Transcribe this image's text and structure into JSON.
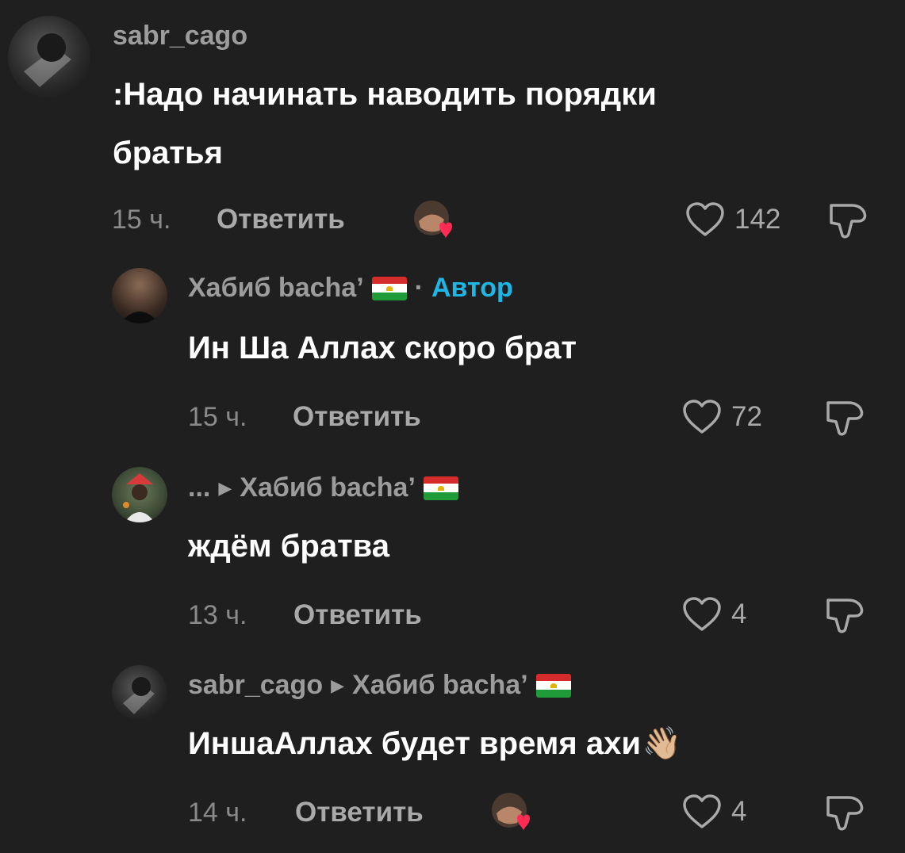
{
  "comments": [
    {
      "username": "sabr_cago",
      "text_line1": ":Надо начинать наводить порядки",
      "text_line2": "братья",
      "time": "15 ч.",
      "reply_label": "Ответить",
      "likes": "142",
      "creator_liked": true
    },
    {
      "username": "Хабиб bacha’",
      "separator": "·",
      "author_badge": "Автор",
      "text": "Ин Ша Аллах скоро брат",
      "time": "15 ч.",
      "reply_label": "Ответить",
      "likes": "72",
      "creator_liked": false
    },
    {
      "username": "...",
      "reply_to": "Хабиб bacha’",
      "text": "ждём братва",
      "time": "13 ч.",
      "reply_label": "Ответить",
      "likes": "4",
      "creator_liked": false
    },
    {
      "username": "sabr_cago",
      "reply_to": "Хабиб bacha’",
      "text": "ИншаАллах будет время ахи",
      "emoji": "👋🏼",
      "time": "14 ч.",
      "reply_label": "Ответить",
      "likes": "4",
      "creator_liked": true
    }
  ],
  "icons": {
    "like": "heart-outline-icon",
    "dislike": "thumbs-down-icon",
    "flag": "tajikistan-flag-icon",
    "reply_arrow": "triangle-right-icon"
  },
  "colors": {
    "background": "#1f1f1f",
    "author_badge": "#1fb6e6",
    "heart_badge": "#fe2c55"
  }
}
